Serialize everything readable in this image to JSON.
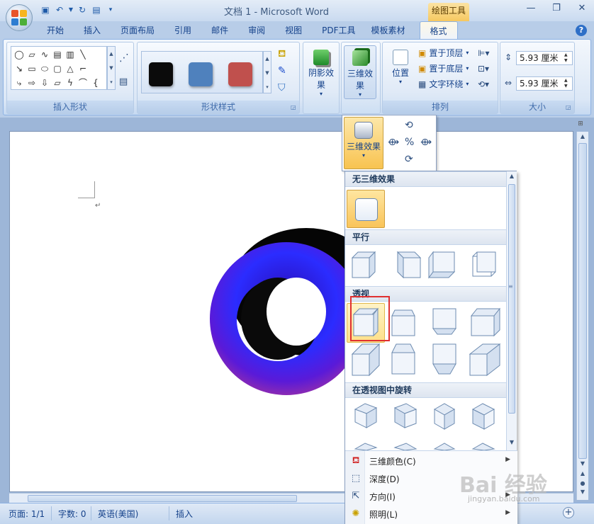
{
  "window": {
    "title": "文档 1 - Microsoft Word",
    "context_tab": "绘图工具",
    "controls": [
      "—",
      "❐",
      "✕"
    ]
  },
  "qat": {
    "icons": [
      "save-icon",
      "undo-icon",
      "redo-icon",
      "quick-print-icon",
      "customize-icon"
    ]
  },
  "tabs": [
    "开始",
    "插入",
    "页面布局",
    "引用",
    "邮件",
    "审阅",
    "视图",
    "PDF工具",
    "模板素材",
    "格式"
  ],
  "active_tab": "格式",
  "ribbon": {
    "insert_shapes_label": "插入形状",
    "shape_styles_label": "形状样式",
    "swatch_colors": [
      "#0b0b0b",
      "#4f81bd",
      "#c0504d"
    ],
    "shadow_effects": "阴影效果",
    "three_d_effects": "三维效果",
    "position": "位置",
    "bring_to_front": "置于顶层",
    "send_to_back": "置于底层",
    "text_wrap": "文字环绕",
    "arrange_label": "排列",
    "height_value": "5.93 厘米",
    "width_value": "5.93 厘米",
    "size_label": "大小"
  },
  "status": {
    "page": "页面: 1/1",
    "words": "字数: 0",
    "language": "英语(美国)",
    "mode": "插入"
  },
  "dropdown": {
    "button_label": "三维效果",
    "sections": {
      "none": "无三维效果",
      "parallel": "平行",
      "perspective": "透视",
      "rotate": "在透视图中旋转"
    },
    "menu": [
      {
        "label": "三维颜色(C)",
        "icon": "3d-color-icon"
      },
      {
        "label": "深度(D)",
        "icon": "depth-icon"
      },
      {
        "label": "方向(I)",
        "icon": "direction-icon"
      },
      {
        "label": "照明(L)",
        "icon": "lighting-icon"
      }
    ]
  },
  "watermark": {
    "text": "Bai 经验",
    "sub": "jingyan.baidu.com"
  }
}
